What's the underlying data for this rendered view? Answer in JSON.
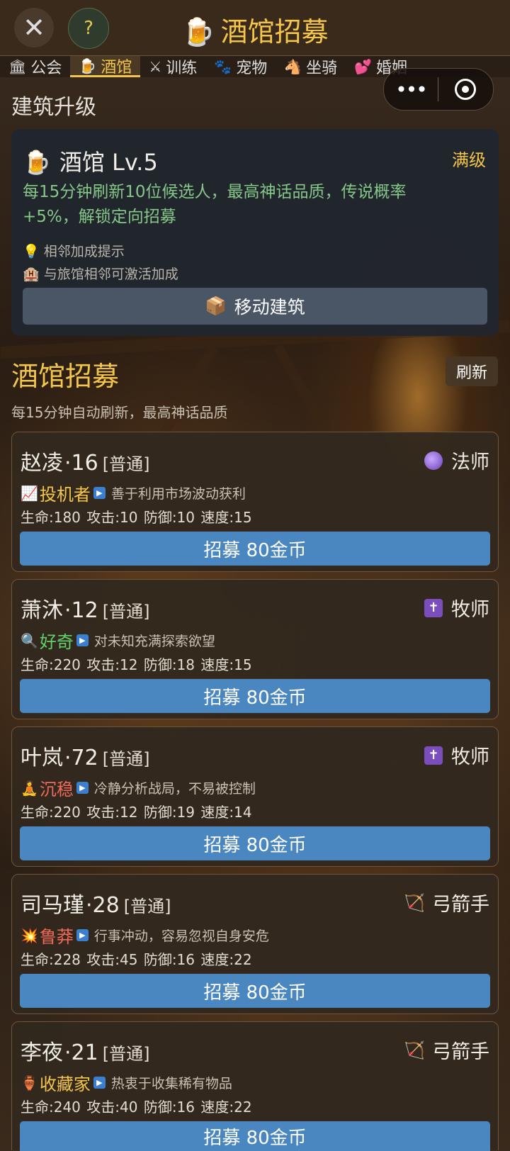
{
  "header": {
    "title_icon": "🍺",
    "title": "酒馆招募",
    "close_icon": "✕",
    "help_icon": "?"
  },
  "tabs": [
    {
      "icon": "🏛",
      "label": "公会",
      "active": false
    },
    {
      "icon": "🍺",
      "label": "酒馆",
      "active": true
    },
    {
      "icon": "⚔",
      "label": "训练",
      "active": false
    },
    {
      "icon": "🐾",
      "label": "宠物",
      "active": false
    },
    {
      "icon": "🐴",
      "label": "坐骑",
      "active": false
    },
    {
      "icon": "💕",
      "label": "婚姻",
      "active": false
    }
  ],
  "capsule": {
    "more_icon": "•••",
    "close_icon": "target"
  },
  "building_section": {
    "heading": "建筑升级"
  },
  "building": {
    "icon": "🍺",
    "name": "酒馆 Lv.5",
    "status": "满级",
    "description": "每15分钟刷新10位候选人，最高神话品质，传说概率+5%，解锁定向招募",
    "tip_icon": "💡",
    "tip_title": "相邻加成提示",
    "tip2_icon": "🏨",
    "tip2_text": "与旅馆相邻可激活加成",
    "move_icon": "📦",
    "move_label": "移动建筑"
  },
  "recruit": {
    "heading": "酒馆招募",
    "refresh_label": "刷新",
    "subtitle": "每15分钟自动刷新，最高神话品质"
  },
  "accent_colors": {
    "gold": "#f3c54b",
    "green": "#86c78a",
    "button_blue": "#4a86c0"
  },
  "candidates": [
    {
      "name": "赵凌",
      "age": "·16",
      "rank": "[普通]",
      "class_icon": "orb",
      "class": "法师",
      "trait_icon": "📈",
      "trait": "投机者",
      "trait_color": "#f3c54b",
      "trait_desc": "善于利用市场波动获利",
      "stats": "生命:180 攻击:10 防御:10 速度:15",
      "button": "招募 80金币"
    },
    {
      "name": "萧沐",
      "age": "·12",
      "rank": "[普通]",
      "class_icon": "cross",
      "class": "牧师",
      "trait_icon": "🔍",
      "trait": "好奇",
      "trait_color": "#5fd36a",
      "trait_desc": "对未知充满探索欲望",
      "stats": "生命:220 攻击:12 防御:18 速度:15",
      "button": "招募 80金币"
    },
    {
      "name": "叶岚",
      "age": "·72",
      "rank": "[普通]",
      "class_icon": "cross",
      "class": "牧师",
      "trait_icon": "🧘",
      "trait": "沉稳",
      "trait_color": "#ef6a5a",
      "trait_desc": "冷静分析战局，不易被控制",
      "stats": "生命:220 攻击:12 防御:19 速度:14",
      "button": "招募 80金币"
    },
    {
      "name": "司马瑾",
      "age": "·28",
      "rank": "[普通]",
      "class_icon": "bow",
      "class": "弓箭手",
      "trait_icon": "💥",
      "trait": "鲁莽",
      "trait_color": "#ef6a5a",
      "trait_desc": "行事冲动，容易忽视自身安危",
      "stats": "生命:228 攻击:45 防御:16 速度:22",
      "button": "招募 80金币"
    },
    {
      "name": "李夜",
      "age": "·21",
      "rank": "[普通]",
      "class_icon": "bow",
      "class": "弓箭手",
      "trait_icon": "🏺",
      "trait": "收藏家",
      "trait_color": "#f3c54b",
      "trait_desc": "热衷于收集稀有物品",
      "stats": "生命:240 攻击:40 防御:16 速度:22",
      "button": "招募 80金币"
    }
  ]
}
